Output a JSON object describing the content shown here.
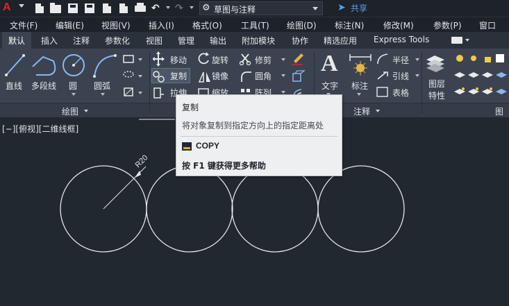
{
  "app": {
    "logo": "A",
    "workspace": "草图与注释",
    "share": "共享"
  },
  "menu": [
    "文件(F)",
    "编辑(E)",
    "视图(V)",
    "插入(I)",
    "格式(O)",
    "工具(T)",
    "绘图(D)",
    "标注(N)",
    "修改(M)",
    "参数(P)",
    "窗口"
  ],
  "tabs": [
    "默认",
    "插入",
    "注释",
    "参数化",
    "视图",
    "管理",
    "输出",
    "附加模块",
    "协作",
    "精选应用",
    "Express Tools"
  ],
  "active_tab": "默认",
  "ribbon": {
    "draw": {
      "title": "绘图",
      "line": "直线",
      "polyline": "多段线",
      "circle": "圆",
      "arc": "圆弧"
    },
    "modify": {
      "move": "移动",
      "rotate": "旋转",
      "trim": "修剪",
      "copy": "复制",
      "mirror": "镜像",
      "fillet": "圆角",
      "stretch": "拉伸",
      "scale": "缩放",
      "array": "阵列"
    },
    "annotation": {
      "title": "注释",
      "text": "文字",
      "dimension": "标注",
      "radius": "半径",
      "leader": "引线",
      "table": "表格"
    },
    "layers": {
      "title": "图层",
      "layer_props": "图层特性"
    }
  },
  "viewport": {
    "label": "[−][俯视][二维线框]"
  },
  "tooltip": {
    "title": "复制",
    "description": "将对象复制到指定方向上的指定距离处",
    "command": "COPY",
    "help": "按 F1 键获得更多帮助"
  },
  "drawing": {
    "dimension_text": "R20"
  },
  "colors": {
    "background": "#212830",
    "ribbon": "#3b4350",
    "accent": "#5aa0e8",
    "logo": "#d8242f"
  }
}
